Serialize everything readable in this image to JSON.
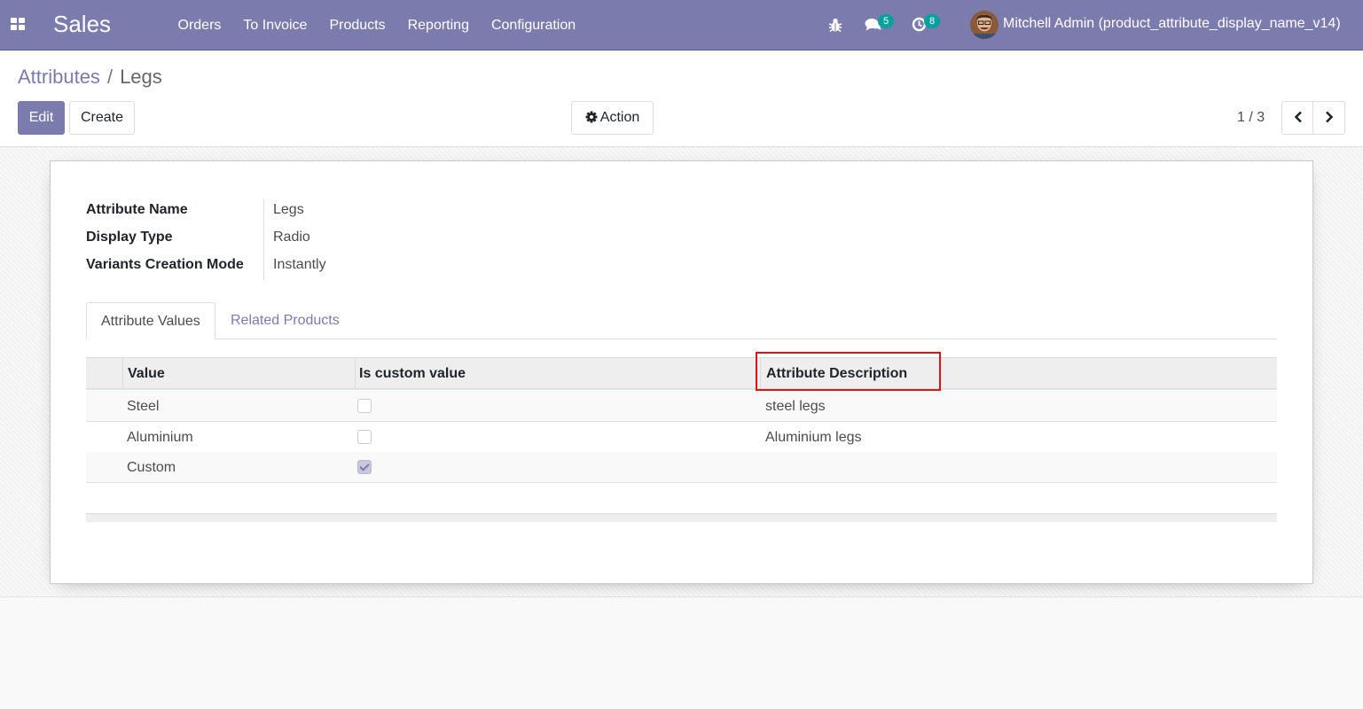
{
  "navbar": {
    "app_name": "Sales",
    "menu": [
      "Orders",
      "To Invoice",
      "Products",
      "Reporting",
      "Configuration"
    ],
    "messages_count": "5",
    "activities_count": "8",
    "user": "Mitchell Admin (product_attribute_display_name_v14)",
    "color": "#7c7bad"
  },
  "breadcrumb": {
    "parent": "Attributes",
    "separator": "/",
    "current": "Legs"
  },
  "buttons": {
    "edit": "Edit",
    "create": "Create",
    "action": "Action"
  },
  "pager": {
    "value": "1 / 3"
  },
  "form": {
    "fields": [
      {
        "label": "Attribute Name",
        "value": "Legs"
      },
      {
        "label": "Display Type",
        "value": "Radio"
      },
      {
        "label": "Variants Creation Mode",
        "value": "Instantly"
      }
    ],
    "tabs": [
      "Attribute Values",
      "Related Products"
    ],
    "active_tab": "Attribute Values"
  },
  "table": {
    "columns": [
      "Value",
      "Is custom value",
      "Attribute Description"
    ],
    "rows": [
      {
        "value": "Steel",
        "is_custom": false,
        "description": "steel legs"
      },
      {
        "value": "Aluminium",
        "is_custom": false,
        "description": "Aluminium legs"
      },
      {
        "value": "Custom",
        "is_custom": true,
        "description": ""
      }
    ]
  },
  "highlight": {
    "target": "Attribute Description",
    "color": "#e01414"
  }
}
